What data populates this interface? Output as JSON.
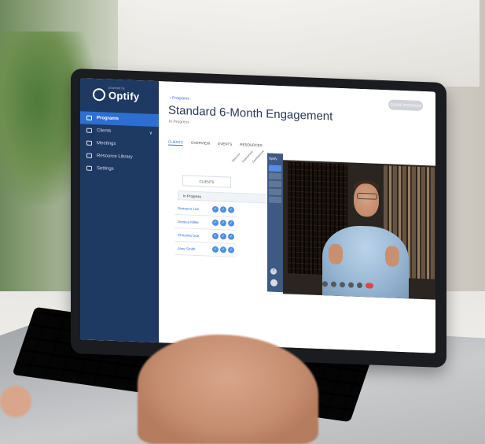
{
  "app": {
    "brand": "Optify",
    "brand_tagline": "powered by"
  },
  "sidebar": {
    "items": [
      {
        "label": "Programs",
        "icon": "edit-icon",
        "active": true
      },
      {
        "label": "Clients",
        "icon": "users-icon",
        "has_caret": true
      },
      {
        "label": "Meetings",
        "icon": "calendar-icon"
      },
      {
        "label": "Resource Library",
        "icon": "book-icon"
      },
      {
        "label": "Settings",
        "icon": "gear-icon"
      }
    ],
    "caret": "∨"
  },
  "header": {
    "back_label": "Programs",
    "close_button": "CLOSE PROGRAM",
    "title": "Standard 6-Month Engagement",
    "status": "In Progress"
  },
  "tabs": [
    "CLIENTS",
    "OVERVIEW",
    "EVENTS",
    "RESOURCES"
  ],
  "grid": {
    "clients_header": "CLIENTS",
    "columns": [
      "Welcome",
      "Assessment",
      "Development"
    ],
    "group_label": "In Progress",
    "rows": [
      {
        "name": "Demarco Lee",
        "checks": 3
      },
      {
        "name": "Jessica Miller",
        "checks": 3
      },
      {
        "name": "Christina Doe",
        "checks": 3
      },
      {
        "name": "Jane Smith",
        "checks": 3
      }
    ],
    "check_glyph": "✓"
  },
  "mini_app": {
    "brand": "Optify",
    "help": "?"
  },
  "colors": {
    "sidebar": "#1e3a63",
    "accent": "#2d6fd1",
    "end_call": "#e0463a"
  }
}
